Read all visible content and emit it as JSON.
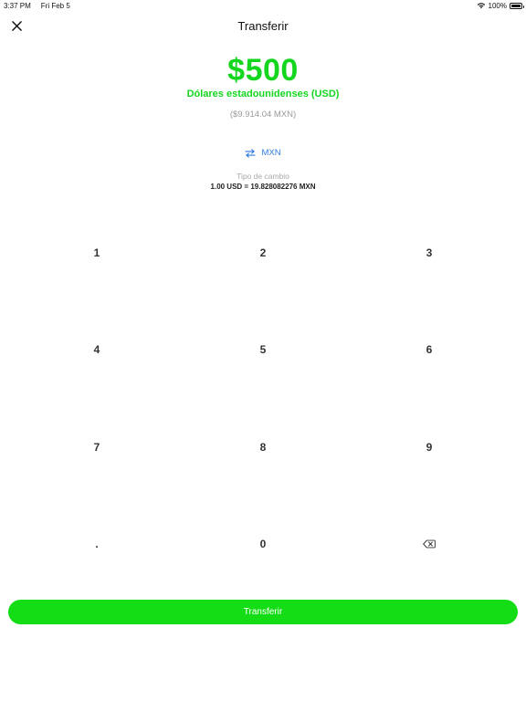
{
  "status_bar": {
    "time": "3:37 PM",
    "date": "Fri Feb 5",
    "battery": "100%",
    "icons": [
      "wifi-icon",
      "battery-icon"
    ]
  },
  "header": {
    "title": "Transferir",
    "close_icon": "close-icon"
  },
  "amount": {
    "value": "$500",
    "currency_name": "Dólares estadounidenses (USD)",
    "converted": "($9.914.04 MXN)"
  },
  "swap": {
    "label": "MXN",
    "icon": "swap-arrows-icon"
  },
  "exchange_rate": {
    "label": "Tipo de cambio",
    "value": "1.00 USD = 19.828082276 MXN"
  },
  "keypad": {
    "keys": [
      "1",
      "2",
      "3",
      "4",
      "5",
      "6",
      "7",
      "8",
      "9",
      ".",
      "0"
    ],
    "backspace_icon": "backspace-icon"
  },
  "primary_action": {
    "label": "Transferir"
  },
  "colors": {
    "accent_green": "#14d61f",
    "button_green": "#14dc15",
    "link_blue": "#2e7bdb"
  }
}
